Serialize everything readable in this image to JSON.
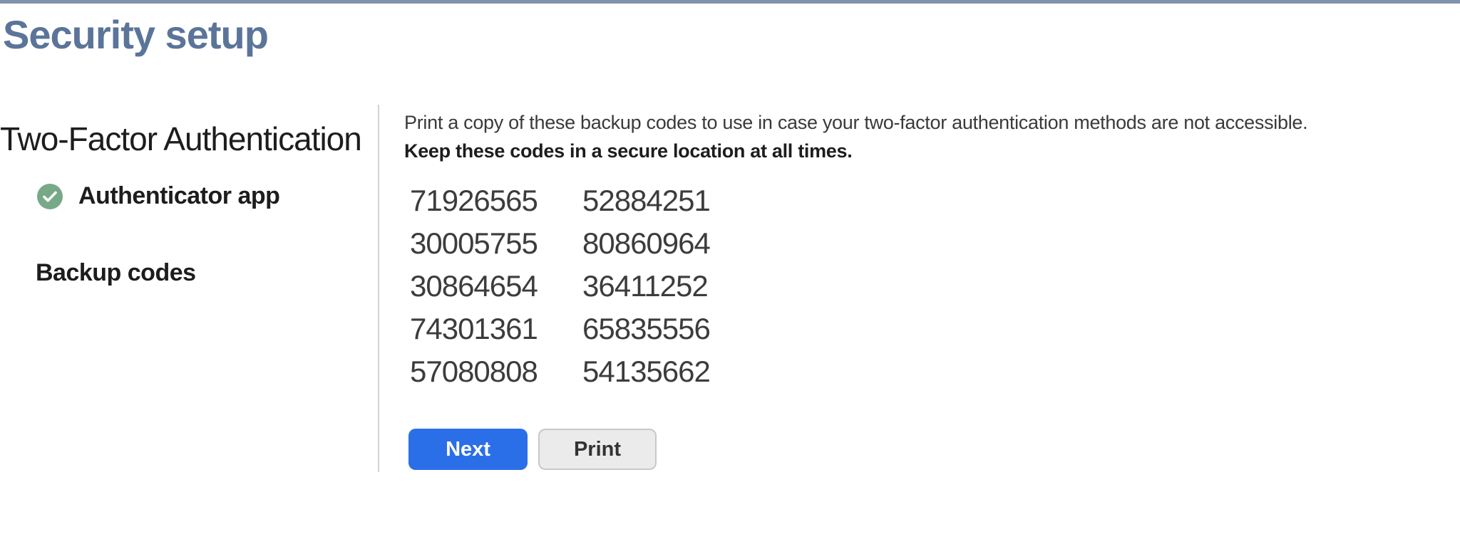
{
  "page": {
    "title": "Security setup"
  },
  "theme": {
    "accent_bar": "#8093ab",
    "title_color": "#5b7499",
    "primary_blue": "#2b6fe8",
    "check_green": "#78a987",
    "divider": "#d2d2d2",
    "print_bg": "#ebebeb",
    "print_border": "#c8c8c8"
  },
  "sidebar": {
    "heading": "Two-Factor Authentication",
    "items": [
      {
        "label": "Authenticator app",
        "completed": true
      },
      {
        "label": "Backup codes",
        "completed": false
      }
    ]
  },
  "content": {
    "instructions_line1": "Print a copy of these backup codes to use in case your two-factor authentication methods are not accessible.",
    "instructions_line2": "Keep these codes in a secure location at all times.",
    "backup_codes": {
      "column1": [
        "71926565",
        "30005755",
        "30864654",
        "74301361",
        "57080808"
      ],
      "column2": [
        "52884251",
        "80860964",
        "36411252",
        "65835556",
        "54135662"
      ]
    },
    "buttons": {
      "next": "Next",
      "print": "Print"
    }
  }
}
